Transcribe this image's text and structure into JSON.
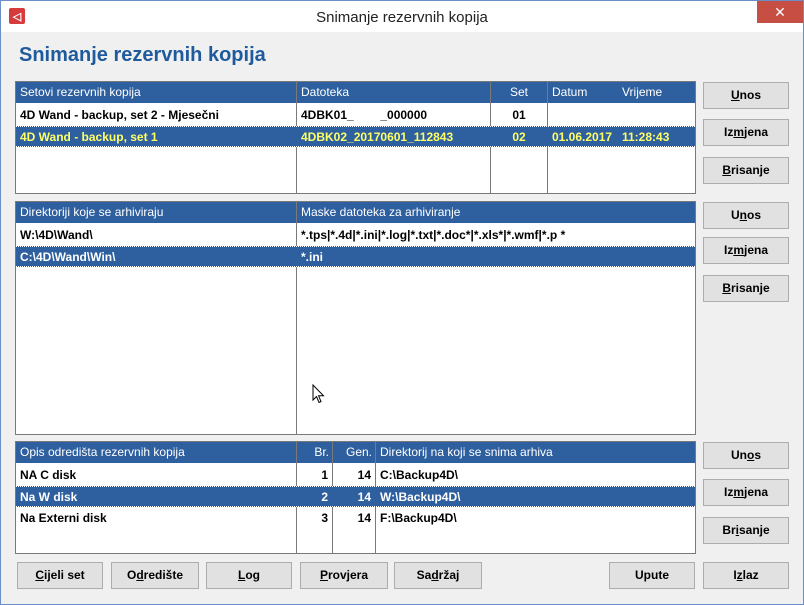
{
  "window": {
    "title": "Snimanje rezervnih kopija",
    "close_glyph": "✕",
    "app_icon_glyph": "◁"
  },
  "heading": "Snimanje rezervnih kopija",
  "sets": {
    "headers": {
      "name": "Setovi rezervnih kopija",
      "file": "Datoteka",
      "set": "Set",
      "date": "Datum",
      "time": "Vrijeme"
    },
    "rows": [
      {
        "name": "4D Wand - backup, set 2 - Mjesečni",
        "file": "4DBK01_        _000000",
        "set": "01",
        "date": "",
        "time": ""
      },
      {
        "name": "4D Wand - backup, set 1",
        "file": "4DBK02_20170601_112843",
        "set": "02",
        "date": "01.06.2017",
        "time": "11:28:43"
      }
    ],
    "buttons": {
      "add": [
        "",
        "U",
        "nos"
      ],
      "edit": [
        "Iz",
        "m",
        "jena"
      ],
      "delete": [
        "",
        "B",
        "risanje"
      ]
    }
  },
  "dirs": {
    "headers": {
      "dir": "Direktoriji koje se arhiviraju",
      "mask": "Maske datoteka za arhiviranje"
    },
    "rows": [
      {
        "dir": "W:\\4D\\Wand\\",
        "mask": "*.tps|*.4d|*.ini|*.log|*.txt|*.doc*|*.xls*|*.wmf|*.p *"
      },
      {
        "dir": "C:\\4D\\Wand\\Win\\",
        "mask": "*.ini"
      }
    ],
    "buttons": {
      "add": [
        "U",
        "n",
        "os"
      ],
      "edit": [
        "Iz",
        "m",
        "jena"
      ],
      "delete": [
        "",
        "B",
        "risanje"
      ]
    }
  },
  "dest": {
    "headers": {
      "desc": "Opis odredišta rezervnih kopija",
      "br": "Br.",
      "gen": "Gen.",
      "dir": "Direktorij na koji se snima arhiva"
    },
    "rows": [
      {
        "desc": "NA C disk",
        "br": "1",
        "gen": "14",
        "dir": "C:\\Backup4D\\"
      },
      {
        "desc": "Na W disk",
        "br": "2",
        "gen": "14",
        "dir": "W:\\Backup4D\\"
      },
      {
        "desc": "Na Externi disk",
        "br": "3",
        "gen": "14",
        "dir": "F:\\Backup4D\\"
      }
    ],
    "buttons": {
      "add": [
        "Un",
        "o",
        "s"
      ],
      "edit": [
        "Iz",
        "m",
        "jena"
      ],
      "delete": [
        "Br",
        "i",
        "sanje"
      ]
    }
  },
  "bottom_buttons": {
    "cijeli_set": [
      "",
      "C",
      "ijeli set"
    ],
    "odrediste": [
      "O",
      "d",
      "redište"
    ],
    "log": [
      "",
      "L",
      "og"
    ],
    "provjera": [
      "",
      "P",
      "rovjera"
    ],
    "sadrzaj": [
      "Sa",
      "d",
      "ržaj"
    ],
    "upute": [
      "Upute",
      "",
      ""
    ],
    "izlaz": [
      "I",
      "z",
      "laz"
    ]
  },
  "colors": {
    "header_bg": "#2e5f9f",
    "heading": "#1f5b9c",
    "selected_text_yellow": "#ffff66"
  }
}
